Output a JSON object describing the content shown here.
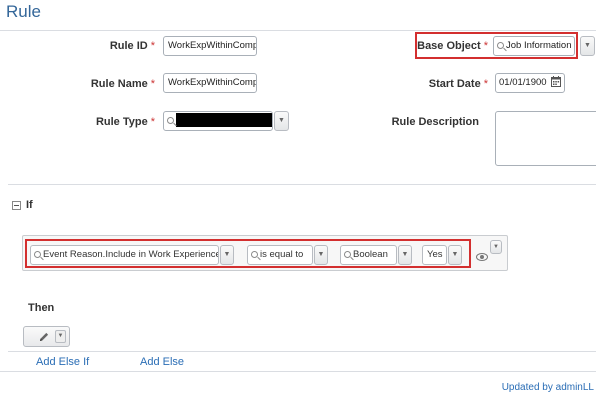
{
  "page": {
    "title": "Rule"
  },
  "fields": {
    "rule_id": {
      "label": "Rule ID",
      "required": "*",
      "value": "WorkExpWithinComp"
    },
    "rule_name": {
      "label": "Rule Name",
      "required": "*",
      "value": "WorkExpWithinComp"
    },
    "rule_type": {
      "label": "Rule Type",
      "required": "*",
      "value": ""
    },
    "base_object": {
      "label": "Base Object",
      "required": "*",
      "value": "Job Information"
    },
    "start_date": {
      "label": "Start Date",
      "required": "*",
      "value": "01/01/1900"
    },
    "rule_description": {
      "label": "Rule Description",
      "value": ""
    }
  },
  "if_section": {
    "label": "If",
    "condition": {
      "field": "Event Reason.Include in Work Experience",
      "operator": "is equal to",
      "type": "Boolean",
      "value": "Yes"
    }
  },
  "then_section": {
    "label": "Then"
  },
  "links": {
    "add_else_if": "Add Else If",
    "add_else": "Add Else"
  },
  "footer": {
    "updated_by": "Updated by adminLL"
  },
  "icons": {
    "search": "search-icon",
    "calendar": "calendar-icon",
    "dropdown": "chevron-down-icon",
    "visibility": "eye-icon",
    "edit": "pencil-icon",
    "collapse": "collapse-icon"
  },
  "colors": {
    "title": "#336699",
    "highlight": "#d32f2f",
    "link": "#2a6db5",
    "required": "#cc3333"
  }
}
